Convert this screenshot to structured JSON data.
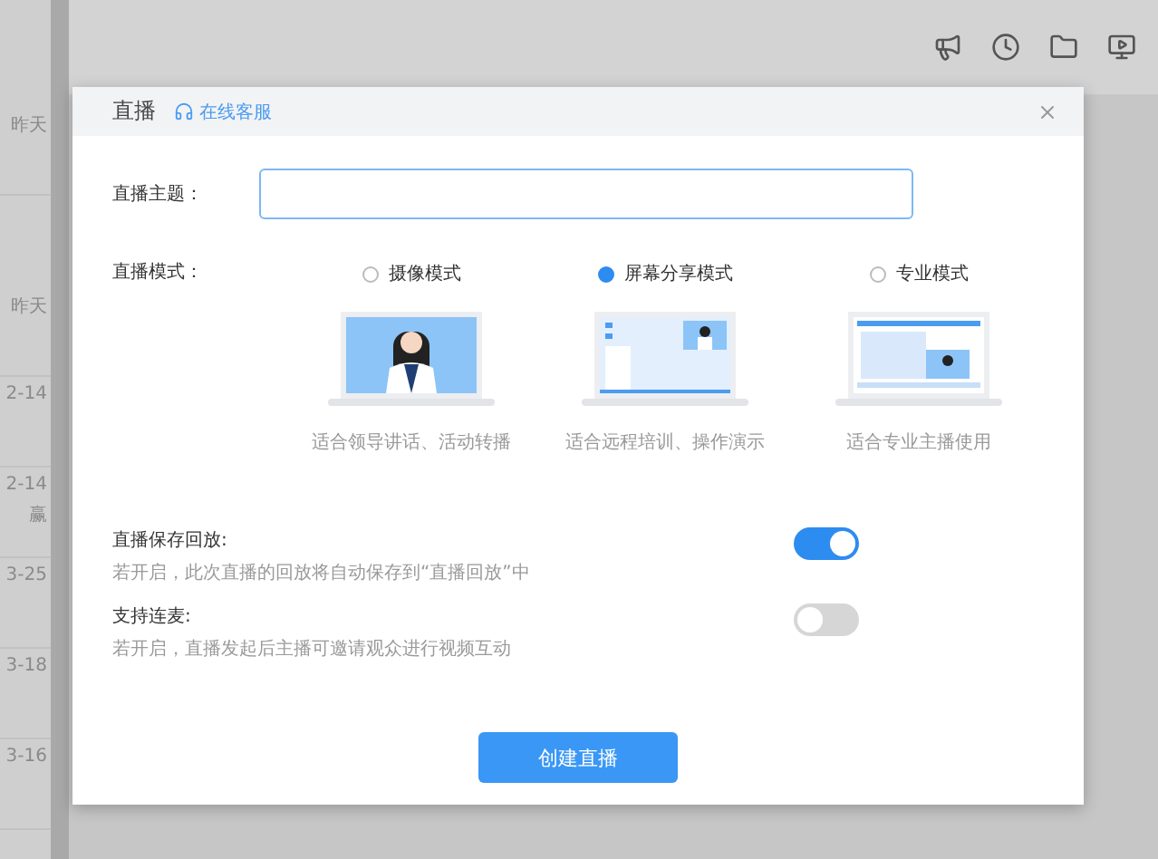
{
  "sidebar": {
    "items": [
      {
        "date": "昨天"
      },
      {
        "date": "昨天"
      },
      {
        "date": "2-14"
      },
      {
        "date": "2-14",
        "note": "赢"
      },
      {
        "date": "3-25"
      },
      {
        "date": "3-18"
      },
      {
        "date": "3-16"
      }
    ]
  },
  "dialog": {
    "title": "直播",
    "support_link": "在线客服",
    "topic": {
      "label": "直播主题：",
      "focused": true
    },
    "modes": {
      "label": "直播模式：",
      "options": [
        {
          "kind": "camera",
          "label": "摄像模式",
          "caption": "适合领导讲话、活动转播",
          "selected": false
        },
        {
          "kind": "screen",
          "label": "屏幕分享模式",
          "caption": "适合远程培训、操作演示",
          "selected": true
        },
        {
          "kind": "pro",
          "label": "专业模式",
          "caption": "适合专业主播使用",
          "selected": false
        }
      ]
    },
    "toggles": [
      {
        "title": "直播保存回放:",
        "description": "若开启，此次直播的回放将自动保存到“直播回放”中",
        "on": true
      },
      {
        "title": "支持连麦:",
        "description": "若开启，直播发起后主播可邀请观众进行视频互动",
        "on": false
      }
    ],
    "button": "创建直播"
  }
}
